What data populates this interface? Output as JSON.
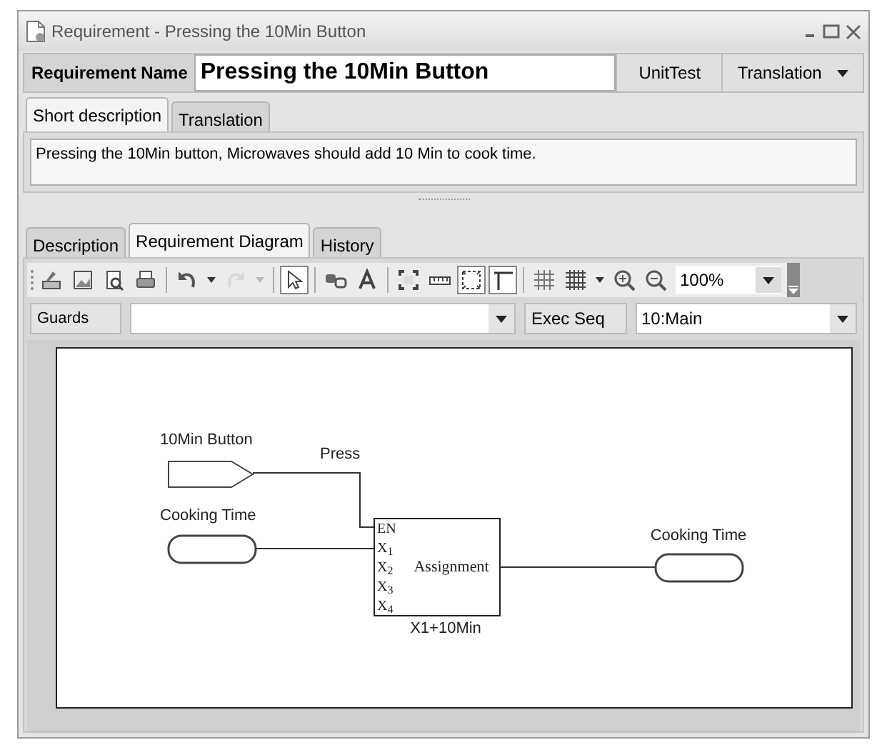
{
  "window": {
    "title": "Requirement - Pressing the 10Min Button"
  },
  "requirement_name": {
    "label": "Requirement Name",
    "value": "Pressing the 10Min Button"
  },
  "header_buttons": [
    "UnitTest",
    "Translation"
  ],
  "short_tabs": [
    {
      "label": "Short description",
      "selected": true
    },
    {
      "label": "Translation",
      "selected": false
    }
  ],
  "short_description": "Pressing the 10Min button, Microwaves should add 10 Min to cook time.",
  "main_tabs": [
    {
      "label": "Description",
      "selected": false
    },
    {
      "label": "Requirement Diagram",
      "selected": true
    },
    {
      "label": "History",
      "selected": false
    }
  ],
  "toolbar": {
    "buttons": [
      {
        "selected": false,
        "disabled": false
      },
      {
        "selected": false,
        "disabled": false
      },
      {
        "selected": false,
        "disabled": false
      },
      {
        "selected": false,
        "disabled": false
      },
      {
        "selected": false,
        "disabled": false
      },
      {
        "selected": false,
        "disabled": true
      },
      {
        "selected": true,
        "disabled": false
      },
      {
        "selected": false,
        "disabled": false
      },
      {
        "selected": false,
        "disabled": false
      },
      {
        "selected": false,
        "disabled": false
      },
      {
        "selected": false,
        "disabled": false
      },
      {
        "selected": true,
        "disabled": false
      },
      {
        "selected": true,
        "disabled": false
      },
      {
        "selected": false,
        "disabled": false
      },
      {
        "selected": false,
        "disabled": false
      },
      {
        "selected": false,
        "disabled": false
      },
      {
        "selected": false,
        "disabled": false
      }
    ],
    "zoom": "100%"
  },
  "guards": {
    "label": "Guards"
  },
  "exec_seq": {
    "label": "Exec Seq",
    "value": "10:Main"
  },
  "diagram": {
    "inputs": [
      {
        "kind": "event",
        "label": "10Min Button",
        "wire_label": "Press"
      },
      {
        "kind": "data",
        "label": "Cooking Time"
      }
    ],
    "block": {
      "title": "Assignment",
      "ports": [
        "EN",
        "X$_{1}$",
        "X$_{2}$",
        "X$_{3}$",
        "X$_{4}$"
      ],
      "expression": "X1+10Min"
    },
    "outputs": [
      {
        "kind": "data",
        "label": "Cooking Time"
      }
    ]
  }
}
